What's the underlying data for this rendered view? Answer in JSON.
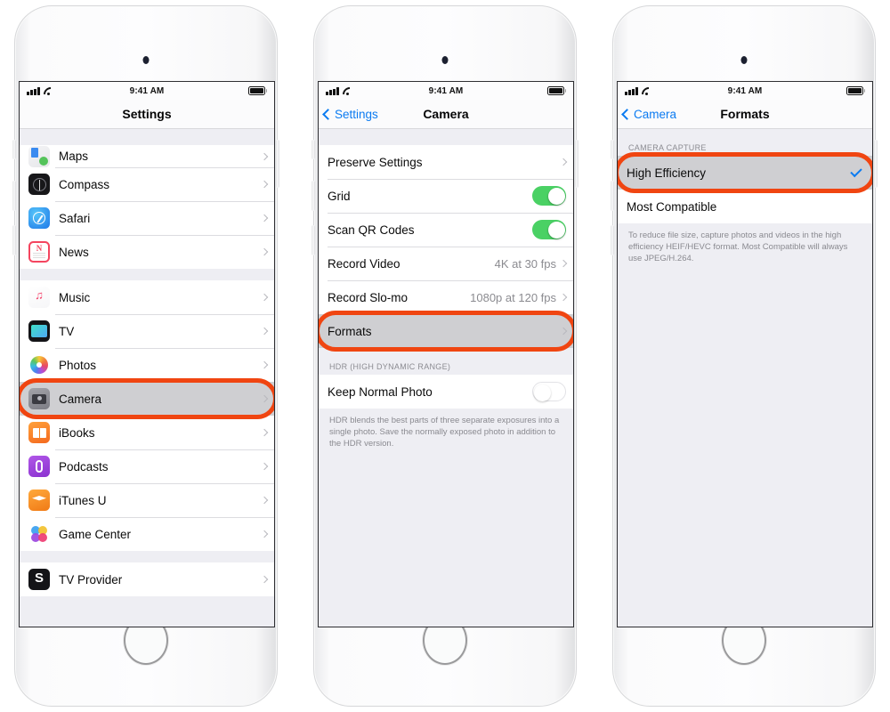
{
  "statusbar": {
    "time": "9:41 AM",
    "signal_icon": "cellular-signal-icon",
    "wifi_icon": "wifi-icon",
    "battery_icon": "battery-full-icon"
  },
  "phones": [
    {
      "id": "phone-settings",
      "nav": {
        "title": "Settings",
        "back_label": "",
        "has_back": false
      },
      "groups": [
        {
          "rows": [
            {
              "label": "Maps",
              "icon": "maps-icon",
              "accessory": "chevron",
              "partial": true
            },
            {
              "label": "Compass",
              "icon": "compass-icon",
              "accessory": "chevron"
            },
            {
              "label": "Safari",
              "icon": "safari-icon",
              "accessory": "chevron"
            },
            {
              "label": "News",
              "icon": "news-icon",
              "accessory": "chevron"
            }
          ]
        },
        {
          "rows": [
            {
              "label": "Music",
              "icon": "music-icon",
              "accessory": "chevron"
            },
            {
              "label": "TV",
              "icon": "tv-icon",
              "accessory": "chevron"
            },
            {
              "label": "Photos",
              "icon": "photos-icon",
              "accessory": "chevron"
            },
            {
              "label": "Camera",
              "icon": "camera-icon",
              "accessory": "chevron",
              "selected": true,
              "highlighted": true
            },
            {
              "label": "iBooks",
              "icon": "ibooks-icon",
              "accessory": "chevron"
            },
            {
              "label": "Podcasts",
              "icon": "podcasts-icon",
              "accessory": "chevron"
            },
            {
              "label": "iTunes U",
              "icon": "itunes-u-icon",
              "accessory": "chevron"
            },
            {
              "label": "Game Center",
              "icon": "game-center-icon",
              "accessory": "chevron"
            }
          ]
        },
        {
          "rows": [
            {
              "label": "TV Provider",
              "icon": "tv-provider-icon",
              "accessory": "chevron"
            }
          ]
        }
      ]
    },
    {
      "id": "phone-camera",
      "nav": {
        "title": "Camera",
        "back_label": "Settings",
        "has_back": true
      },
      "groups": [
        {
          "rows": [
            {
              "label": "Preserve Settings",
              "accessory": "chevron"
            },
            {
              "label": "Grid",
              "accessory": "toggle",
              "toggle": "on"
            },
            {
              "label": "Scan QR Codes",
              "accessory": "toggle",
              "toggle": "on"
            },
            {
              "label": "Record Video",
              "accessory": "chevron",
              "value": "4K at 30 fps"
            },
            {
              "label": "Record Slo-mo",
              "accessory": "chevron",
              "value": "1080p at 120 fps"
            },
            {
              "label": "Formats",
              "accessory": "chevron",
              "selected": true,
              "highlighted": true
            }
          ]
        },
        {
          "header": "HDR (HIGH DYNAMIC RANGE)",
          "rows": [
            {
              "label": "Keep Normal Photo",
              "accessory": "toggle",
              "toggle": "off"
            }
          ],
          "footnote": "HDR blends the best parts of three separate exposures into a single photo. Save the normally exposed photo in addition to the HDR version."
        }
      ]
    },
    {
      "id": "phone-formats",
      "nav": {
        "title": "Formats",
        "back_label": "Camera",
        "has_back": true
      },
      "groups": [
        {
          "header": "CAMERA CAPTURE",
          "rows": [
            {
              "label": "High Efficiency",
              "accessory": "check",
              "selected": true,
              "highlighted": true
            },
            {
              "label": "Most Compatible",
              "accessory": "none"
            }
          ],
          "footnote": "To reduce file size, capture photos and videos in the high efficiency HEIF/HEVC format. Most Compatible will always use JPEG/H.264."
        }
      ]
    }
  ],
  "colors": {
    "accent_blue": "#0b7bf1",
    "toggle_green": "#4ad164",
    "highlight_orange": "#f04511",
    "selected_row_gray": "#cfcfd2",
    "screen_background": "#eeeef3"
  }
}
